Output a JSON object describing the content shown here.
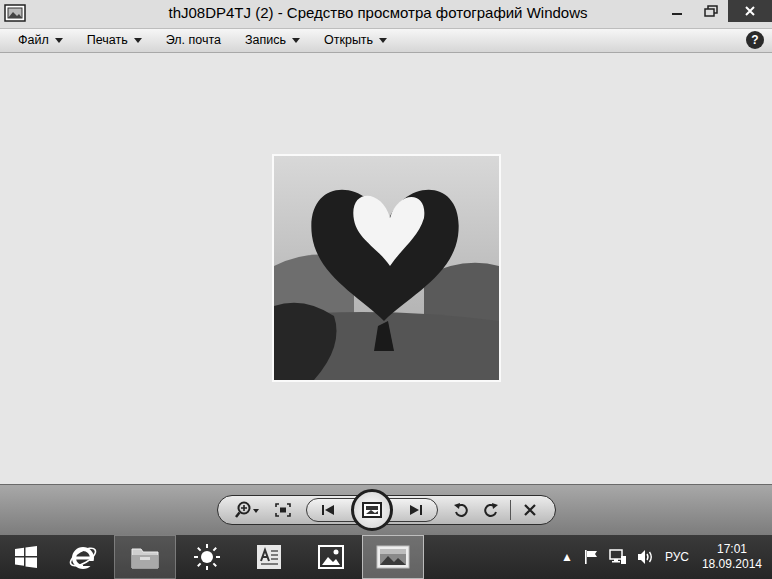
{
  "window": {
    "title": "thJ08DP4TJ (2) - Средство просмотра фотографий Windows"
  },
  "menu": [
    {
      "label": "Файл",
      "dropdown": true
    },
    {
      "label": "Печать",
      "dropdown": true
    },
    {
      "label": "Эл. почта",
      "dropdown": false
    },
    {
      "label": "Запись",
      "dropdown": true
    },
    {
      "label": "Открыть",
      "dropdown": true
    }
  ],
  "help": "?",
  "taskbar": {
    "apps": [
      {
        "running": false,
        "selected": false
      },
      {
        "running": true,
        "selected": false
      },
      {
        "running": false,
        "selected": false
      },
      {
        "running": false,
        "selected": false
      },
      {
        "running": false,
        "selected": false
      },
      {
        "running": true,
        "selected": true
      }
    ]
  },
  "tray": {
    "overflow": "▲",
    "language": "РУС",
    "time": "17:01",
    "date": "18.09.2014"
  }
}
